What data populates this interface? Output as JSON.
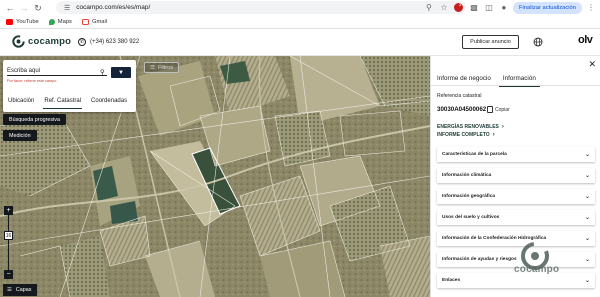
{
  "browser": {
    "url": "cocampo.com/es/es/map/",
    "update_label": "Finalizar actualización",
    "bookmarks": [
      {
        "label": "YouTube",
        "color": "#ff0000"
      },
      {
        "label": "Maps",
        "color": "#34a853"
      },
      {
        "label": "Gmail",
        "color": "#ea4335"
      }
    ],
    "notification_count": "2"
  },
  "header": {
    "logo_text": "cocampo",
    "phone": "(+34) 623 380 922",
    "publish_label": "Publicar anuncio",
    "brand_right": "olv"
  },
  "search": {
    "placeholder": "Escriba aquí",
    "hint": "Por favor, rellene este campo",
    "tabs": [
      "Ubicación",
      "Ref. Catastral",
      "Coordenadas"
    ],
    "active_tab": "Ref. Catastral"
  },
  "map": {
    "filter_label": "Filtros",
    "progressive_label": "Búsqueda progresiva",
    "measure_label": "Medición",
    "zoom_in": "+",
    "zoom_out": "−",
    "zoom_level": "16",
    "layers_label": "Capas"
  },
  "panel": {
    "tabs": [
      "Informe de negocio",
      "Información"
    ],
    "active_tab": "Información",
    "ref_label": "Referencia catastral",
    "ref_value": "30030A04500062",
    "copy_label": "Copiar",
    "links": [
      "ENERGÍAS RENOVABLES",
      "INFORME COMPLETO"
    ],
    "sections": [
      "Características de la parcela",
      "Información climática",
      "Información geográfica",
      "Usos del suelo y cultivos",
      "Información de la Confederación Hidrográfica",
      "Información de ayudas y riesgos",
      "Enlaces"
    ]
  },
  "watermark": "cocampo",
  "colors": {
    "brand": "#1d3b35",
    "dark_button": "#15181c",
    "accent_blue": "#0b57d0"
  }
}
